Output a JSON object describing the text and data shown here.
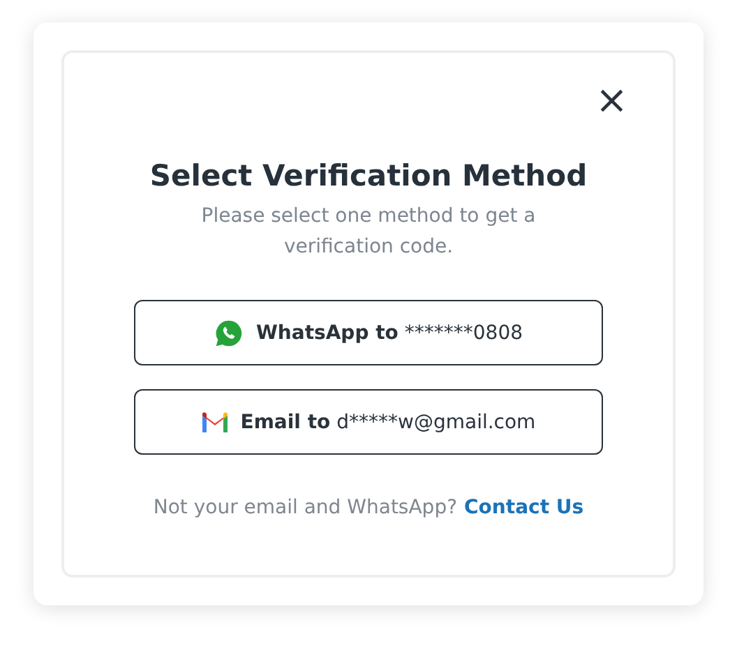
{
  "dialog": {
    "close": "×",
    "title": "Select Verification Method",
    "subtitle": "Please select one method to get a verification code.",
    "options": [
      {
        "kind": "whatsapp",
        "method": "WhatsApp to",
        "target": "*******0808"
      },
      {
        "kind": "email",
        "method": "Email to",
        "target": "d*****w@gmail.com"
      }
    ],
    "footer": {
      "text": "Not your email and WhatsApp?",
      "link": "Contact Us"
    }
  }
}
